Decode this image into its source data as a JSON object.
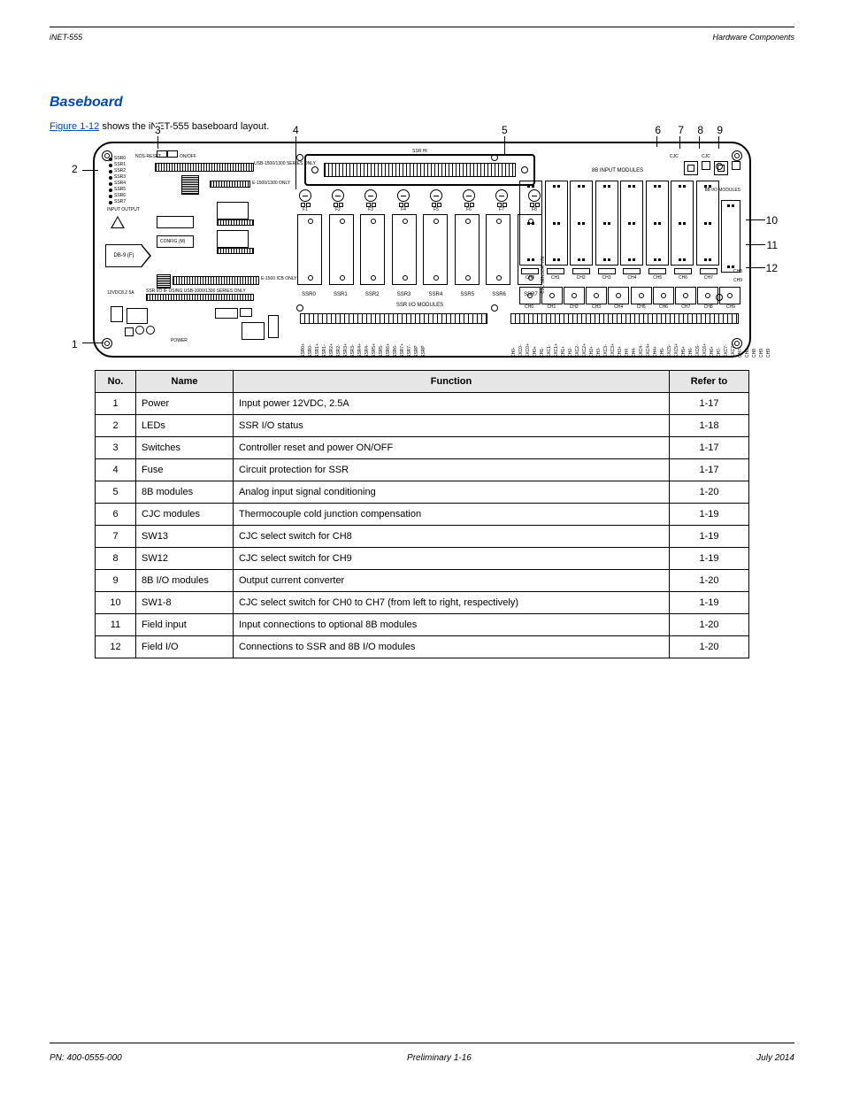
{
  "header": {
    "left_model": "iNET-555",
    "title": "Hardware Components"
  },
  "heading": "Baseboard",
  "figure": {
    "link_text": "Figure 1-12",
    "caption_rest": " shows the iNET-555 baseboard layout."
  },
  "diagram": {
    "callouts": [
      "1",
      "2",
      "3",
      "4",
      "5",
      "6",
      "7",
      "8",
      "9",
      "10",
      "11",
      "12"
    ],
    "ssr_led_labels": [
      "SSR0",
      "SSR1",
      "SSR2",
      "SSR3",
      "SSR4",
      "SSR5",
      "SSR6",
      "SSR7"
    ],
    "io_label": "INPUT   OUTPUT",
    "onoff": "ON/OFF",
    "reset": "NOS-RESET",
    "usb_note1": "USB-1500/1300 SERIES ONLY",
    "usb_note2": "E-1500/1300 ONLY",
    "usb_note3": "E-1500 ICB ONLY",
    "usb_note4": "SSR I/O IF USING   USB-1000/1300 SERIES ONLY",
    "arrow_label": "DB-9 (F)",
    "db9_label": "CONFIG (M)",
    "db9_note": "12VDC8.2 5A",
    "power_label": "POWER",
    "ssr_hi": "SSR HI",
    "ssr_io_title": "SSR I/O MODULES",
    "fuses": [
      "F1",
      "F2",
      "F3",
      "F4",
      "F5",
      "F6",
      "F7",
      "F8"
    ],
    "ssr_mods": [
      "SSR0",
      "SSR1",
      "SSR2",
      "SSR3",
      "SSR4",
      "SSR5",
      "SSR6",
      "SSR7"
    ],
    "bb_title": "8B INPUT MODULES",
    "bb_io_label": "8B I/O MODULES",
    "bb_chs": [
      "CH0",
      "CH1",
      "CH2",
      "CH3",
      "CH4",
      "CH5",
      "CH6",
      "CH7"
    ],
    "bb_bot_chs": [
      "CH0",
      "CH1",
      "CH2",
      "CH3",
      "CH4",
      "CH5",
      "CH6",
      "CH7",
      "CH8",
      "CH9"
    ],
    "bb_side_chs": [
      "CH8",
      "CH9"
    ],
    "cjc_labels": [
      "CJC",
      "CJC"
    ],
    "cjc_side": "CJC SENSOR Y/N",
    "bottom_ssr_sig": [
      "SSR0+",
      "SSR0-",
      "SSR1+",
      "SSR1-",
      "SSR2+",
      "SSR2-",
      "SSR3+",
      "SSR3-",
      "SSR4+",
      "SSR4-",
      "SSR5+",
      "SSR5-",
      "SSR6+",
      "SSR6-",
      "SSR7+",
      "SSR7-",
      "SSRP",
      "SSRP"
    ],
    "bottom_8b_sig": [
      "CH0-",
      "EXC0-",
      "EXC0+",
      "CH0+",
      "CH1-",
      "EXC1-",
      "EXC1+",
      "CH1+",
      "CH2-",
      "EXC2-",
      "EXC2+",
      "CH2+",
      "CH3-",
      "EXC3-",
      "EXC3+",
      "CH3+",
      "CH4",
      "CH4-",
      "EXC4-",
      "EXC4+",
      "CH4+",
      "CH5-",
      "EXC5-",
      "EXC5+",
      "CH5+",
      "CH6-",
      "EXC6-",
      "EXC6+",
      "CH6+",
      "CH7-",
      "EXC7-",
      "EXC7+",
      "CH7+",
      "CH8",
      "CH8",
      "CH9",
      "CH9"
    ]
  },
  "table": {
    "headers": [
      "No.",
      "Name",
      "Function",
      "Refer to"
    ],
    "rows": [
      [
        "1",
        "Power",
        "Input power 12VDC, 2.5A",
        "1-17"
      ],
      [
        "2",
        "LEDs",
        "SSR I/O status",
        "1-18"
      ],
      [
        "3",
        "Switches",
        "Controller reset and power ON/OFF",
        "1-17"
      ],
      [
        "4",
        "Fuse",
        "Circuit protection for SSR",
        "1-17"
      ],
      [
        "5",
        "8B modules",
        "Analog input signal conditioning",
        "1-20"
      ],
      [
        "6",
        "CJC modules",
        "Thermocouple cold junction compensation",
        "1-19"
      ],
      [
        "7",
        "SW13",
        "CJC select switch for CH8",
        "1-19"
      ],
      [
        "8",
        "SW12",
        "CJC select switch for CH9",
        "1-19"
      ],
      [
        "9",
        "8B I/O modules",
        "Output current converter",
        "1-20"
      ],
      [
        "10",
        "SW1-8",
        "CJC select switch for CH0 to CH7 (from left to right, respectively)",
        "1-19"
      ],
      [
        "11",
        "Field input",
        "Input connections to optional 8B modules",
        "1-20"
      ],
      [
        "12",
        "Field I/O",
        "Connections to SSR and 8B I/O modules",
        "1-20"
      ]
    ]
  },
  "footer": {
    "pn": "PN: 400-0555-000",
    "page": "Preliminary 1-16",
    "date": "July 2014"
  }
}
